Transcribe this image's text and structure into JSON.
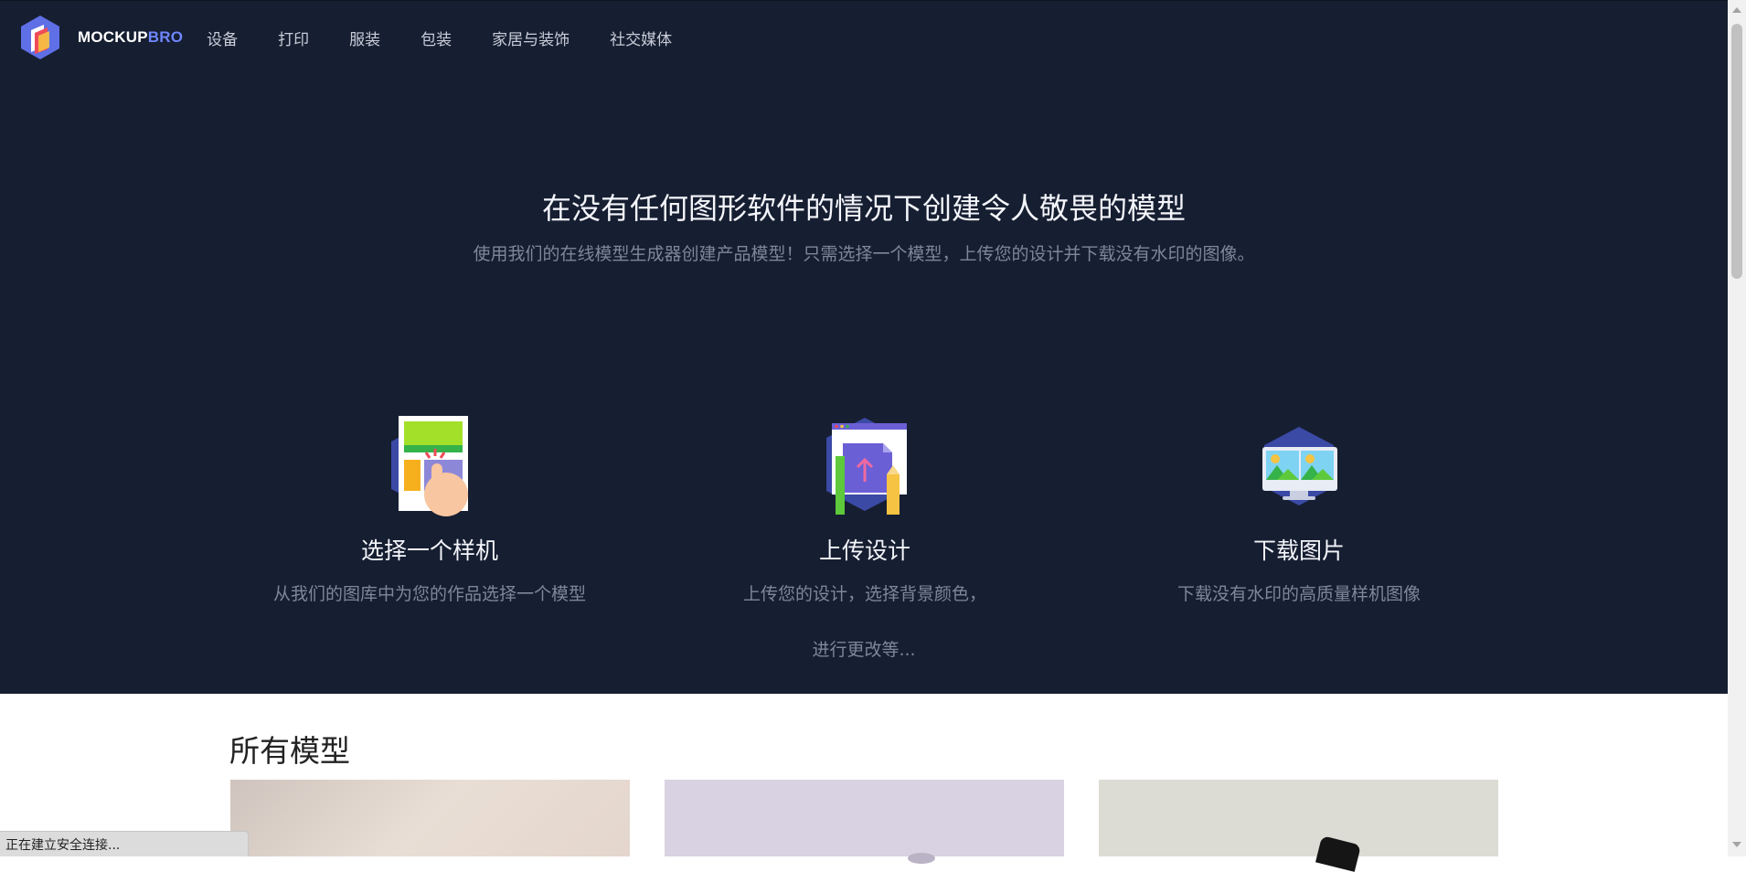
{
  "header": {
    "brand_main": "MOCKUP",
    "brand_accent": "BRO",
    "nav": [
      "设备",
      "打印",
      "服装",
      "包装",
      "家居与装饰",
      "社交媒体"
    ]
  },
  "hero": {
    "title": "在没有任何图形软件的情况下创建令人敬畏的模型",
    "subtitle": "使用我们的在线模型生成器创建产品模型！只需选择一个模型，上传您的设计并下载没有水印的图像。"
  },
  "steps": [
    {
      "icon": "choose-mockup-icon",
      "title": "选择一个样机",
      "desc": "从我们的图库中为您的作品选择一个模型"
    },
    {
      "icon": "upload-design-icon",
      "title": "上传设计",
      "desc": "上传您的设计，选择背景颜色，"
    },
    {
      "icon": "download-images-icon",
      "title": "下载图片",
      "desc": "下载没有水印的高质量样机图像"
    }
  ],
  "steps_extra": "进行更改等...",
  "catalog": {
    "title": "所有模型"
  },
  "browser": {
    "status_text": "正在建立安全连接..."
  },
  "colors": {
    "hero_bg": "#161e31",
    "accent": "#6f86ff",
    "text_muted": "#7e879a"
  }
}
